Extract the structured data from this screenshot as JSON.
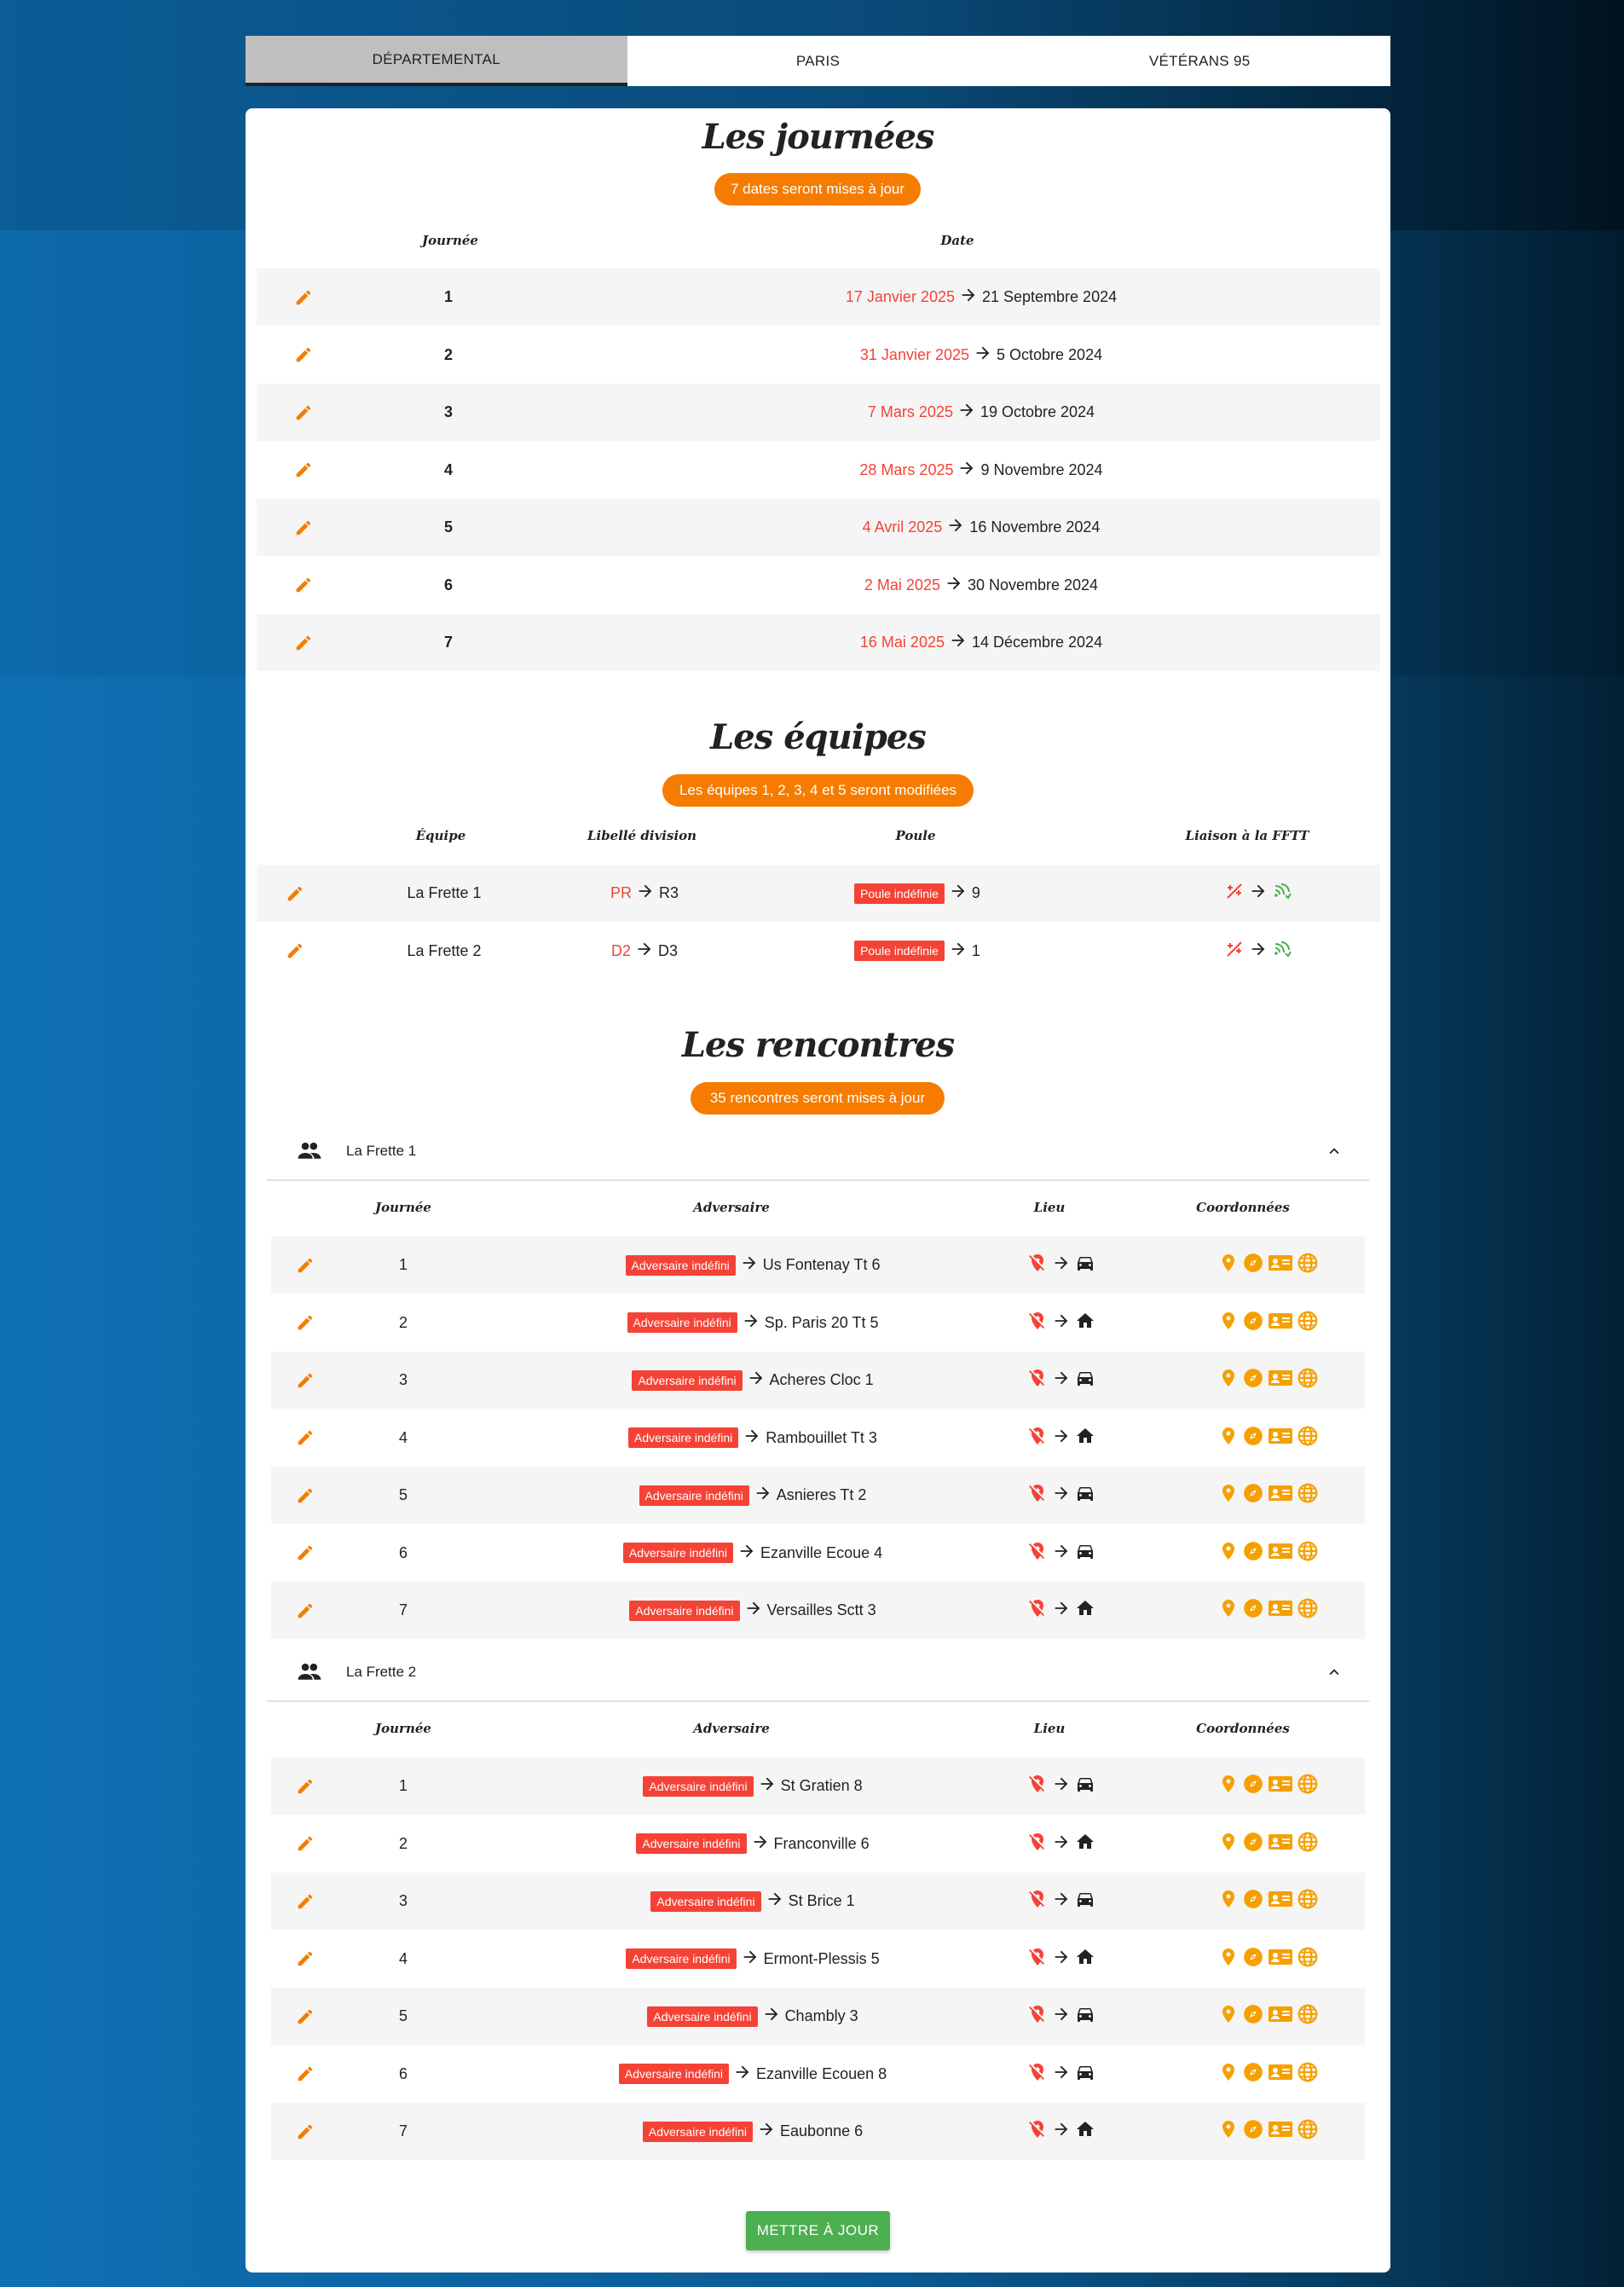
{
  "tabs": [
    {
      "label": "DÉPARTEMENTAL",
      "active": true
    },
    {
      "label": "PARIS",
      "active": false
    },
    {
      "label": "VÉTÉRANS 95",
      "active": false
    }
  ],
  "journees": {
    "title": "Les journées",
    "pill": "7 dates seront mises à jour",
    "headers": {
      "journee": "Journée",
      "date": "Date"
    },
    "rows": [
      {
        "num": "1",
        "old": "17 Janvier 2025",
        "new": "21 Septembre 2024"
      },
      {
        "num": "2",
        "old": "31 Janvier 2025",
        "new": "5 Octobre 2024"
      },
      {
        "num": "3",
        "old": "7 Mars 2025",
        "new": "19 Octobre 2024"
      },
      {
        "num": "4",
        "old": "28 Mars 2025",
        "new": "9 Novembre 2024"
      },
      {
        "num": "5",
        "old": "4 Avril 2025",
        "new": "16 Novembre 2024"
      },
      {
        "num": "6",
        "old": "2 Mai 2025",
        "new": "30 Novembre 2024"
      },
      {
        "num": "7",
        "old": "16 Mai 2025",
        "new": "14 Décembre 2024"
      }
    ]
  },
  "equipes": {
    "title": "Les équipes",
    "pill": "Les équipes 1, 2, 3, 4 et 5 seront modifiées",
    "headers": {
      "equipe": "Équipe",
      "division": "Libellé division",
      "poule": "Poule",
      "liaison": "Liaison à la FFTT"
    },
    "rows": [
      {
        "equipe": "La Frette 1",
        "div_old": "PR",
        "div_new": "R3",
        "poule_old": "Poule indéfinie",
        "poule_new": "9"
      },
      {
        "equipe": "La Frette 2",
        "div_old": "D2",
        "div_new": "D3",
        "poule_old": "Poule indéfinie",
        "poule_new": "1"
      }
    ]
  },
  "rencontres": {
    "title": "Les rencontres",
    "pill": "35 rencontres seront mises à jour",
    "headers": {
      "journee": "Journée",
      "adversaire": "Adversaire",
      "lieu": "Lieu",
      "coordonnees": "Coordonnées"
    },
    "badge": "Adversaire indéfini",
    "groups": [
      {
        "name": "La Frette 1",
        "rows": [
          {
            "num": "1",
            "adv": "Us Fontenay Tt 6",
            "lieu": "car"
          },
          {
            "num": "2",
            "adv": "Sp. Paris 20 Tt 5",
            "lieu": "home"
          },
          {
            "num": "3",
            "adv": "Acheres Cloc 1",
            "lieu": "car"
          },
          {
            "num": "4",
            "adv": "Rambouillet Tt 3",
            "lieu": "home"
          },
          {
            "num": "5",
            "adv": "Asnieres Tt 2",
            "lieu": "car"
          },
          {
            "num": "6",
            "adv": "Ezanville Ecoue 4",
            "lieu": "car"
          },
          {
            "num": "7",
            "adv": "Versailles Sctt 3",
            "lieu": "home"
          }
        ]
      },
      {
        "name": "La Frette 2",
        "rows": [
          {
            "num": "1",
            "adv": "St Gratien 8",
            "lieu": "car"
          },
          {
            "num": "2",
            "adv": "Franconville 6",
            "lieu": "home"
          },
          {
            "num": "3",
            "adv": "St Brice 1",
            "lieu": "car"
          },
          {
            "num": "4",
            "adv": "Ermont-Plessis 5",
            "lieu": "home"
          },
          {
            "num": "5",
            "adv": "Chambly 3",
            "lieu": "car"
          },
          {
            "num": "6",
            "adv": "Ezanville Ecouen 8",
            "lieu": "car"
          },
          {
            "num": "7",
            "adv": "Eaubonne 6",
            "lieu": "home"
          }
        ]
      }
    ]
  },
  "submit_label": "METTRE À JOUR",
  "colors": {
    "accent": "#f57c00",
    "red": "#f44336",
    "green": "#4caf50"
  }
}
